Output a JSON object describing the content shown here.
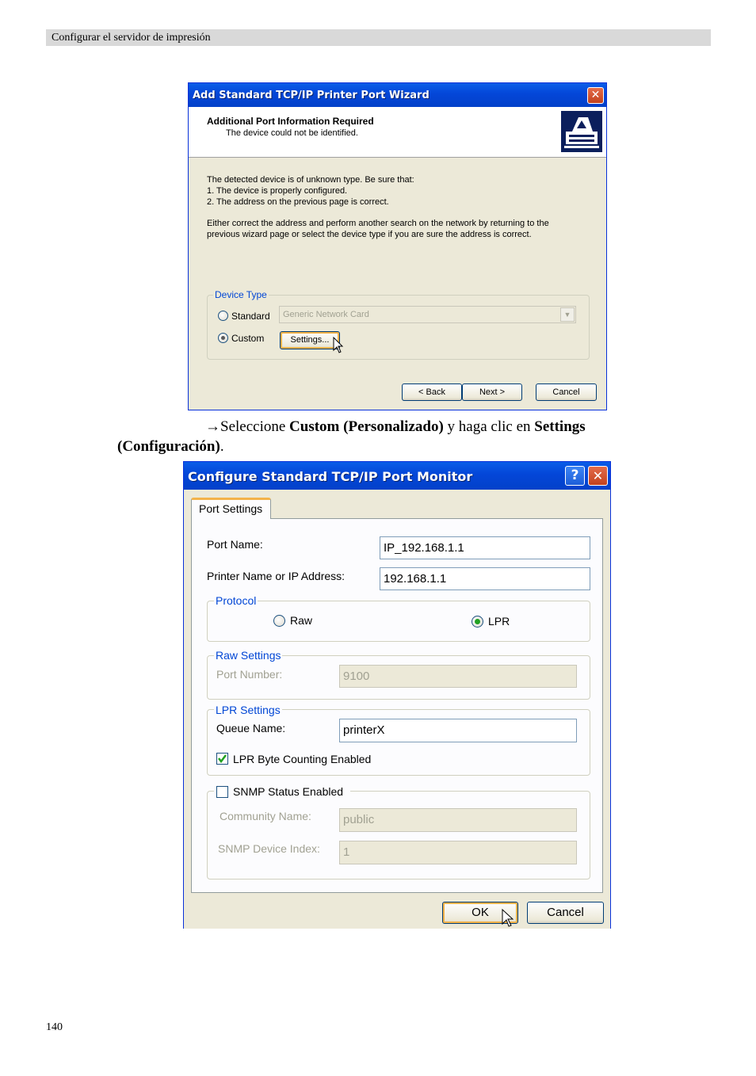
{
  "header": {
    "title": "Configurar el servidor de impresión"
  },
  "wizard": {
    "title": "Add Standard TCP/IP Printer Port Wizard",
    "heading": "Additional Port Information Required",
    "subheading": "The device could not be identified.",
    "body_lines": [
      "The detected device is of unknown type.  Be sure that:",
      "1. The device is properly configured.",
      "2.  The address on the previous page is correct."
    ],
    "body_para": [
      "Either correct the address and perform another search on the network by returning to the",
      "previous wizard page or select the device type if you are sure the address is correct."
    ],
    "device_type_label": "Device Type",
    "standard_label": "Standard",
    "standard_value": "Generic Network Card",
    "custom_label": "Custom",
    "settings_button": "Settings...",
    "back_button": "< Back",
    "next_button": "Next >",
    "cancel_button": "Cancel",
    "selected": "Custom",
    "icon": "printer-network-icon"
  },
  "caption": {
    "arrow": "→",
    "t1": "Seleccione ",
    "b1": "Custom (Personalizado)",
    "t2": " y haga clic en ",
    "b2": "Settings",
    "b3": "(Configuración)",
    "t3": "."
  },
  "monitor": {
    "title": "Configure Standard TCP/IP Port Monitor",
    "help_glyph": "?",
    "tab_label": "Port Settings",
    "port_name_label": "Port Name:",
    "port_name_value": "IP_192.168.1.1",
    "printer_label": "Printer Name or IP Address:",
    "printer_value": "192.168.1.1",
    "protocol_label": "Protocol",
    "raw_label": "Raw",
    "lpr_label": "LPR",
    "protocol_selected": "LPR",
    "raw_settings_label": "Raw Settings",
    "port_number_label": "Port Number:",
    "port_number_value": "9100",
    "lpr_settings_label": "LPR Settings",
    "queue_label": "Queue Name:",
    "queue_value": "printerX",
    "byte_counting_label": "LPR Byte Counting Enabled",
    "byte_counting_checked": true,
    "snmp_label": "SNMP Status Enabled",
    "snmp_checked": false,
    "community_label": "Community Name:",
    "community_value": "public",
    "snmp_index_label": "SNMP Device Index:",
    "snmp_index_value": "1",
    "ok_button": "OK",
    "cancel_button": "Cancel"
  },
  "footer": {
    "page_number": "140"
  },
  "colors": {
    "title_blue": "#0446d8",
    "dialog_bg": "#ece9d8",
    "group_label": "#0046d5",
    "radio_dot": "#21a121",
    "close_red": "#c3421d"
  }
}
